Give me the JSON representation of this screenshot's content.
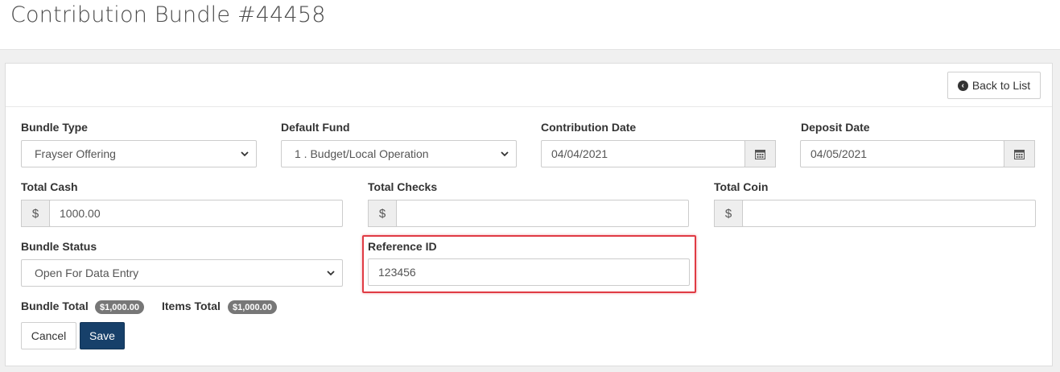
{
  "page": {
    "title": "Contribution Bundle #44458"
  },
  "header": {
    "back_label": "Back to List",
    "back_icon": "arrow-circle-left-icon"
  },
  "form": {
    "bundle_type": {
      "label": "Bundle Type",
      "value": "Frayser Offering"
    },
    "default_fund": {
      "label": "Default Fund",
      "value": "1 . Budget/Local Operation"
    },
    "contribution_date": {
      "label": "Contribution Date",
      "value": "04/04/2021",
      "icon": "calendar-icon"
    },
    "deposit_date": {
      "label": "Deposit Date",
      "value": "04/05/2021",
      "icon": "calendar-icon"
    },
    "total_cash": {
      "label": "Total Cash",
      "prefix": "$",
      "value": "1000.00"
    },
    "total_checks": {
      "label": "Total Checks",
      "prefix": "$",
      "value": ""
    },
    "total_coin": {
      "label": "Total Coin",
      "prefix": "$",
      "value": ""
    },
    "bundle_status": {
      "label": "Bundle Status",
      "value": "Open For Data Entry"
    },
    "reference_id": {
      "label": "Reference ID",
      "value": "123456"
    }
  },
  "totals": {
    "bundle_label": "Bundle Total",
    "bundle_value": "$1,000.00",
    "items_label": "Items Total",
    "items_value": "$1,000.00"
  },
  "actions": {
    "cancel_label": "Cancel",
    "save_label": "Save"
  },
  "colors": {
    "primary": "#17406a",
    "highlight": "#e03b44",
    "badge": "#777777"
  }
}
